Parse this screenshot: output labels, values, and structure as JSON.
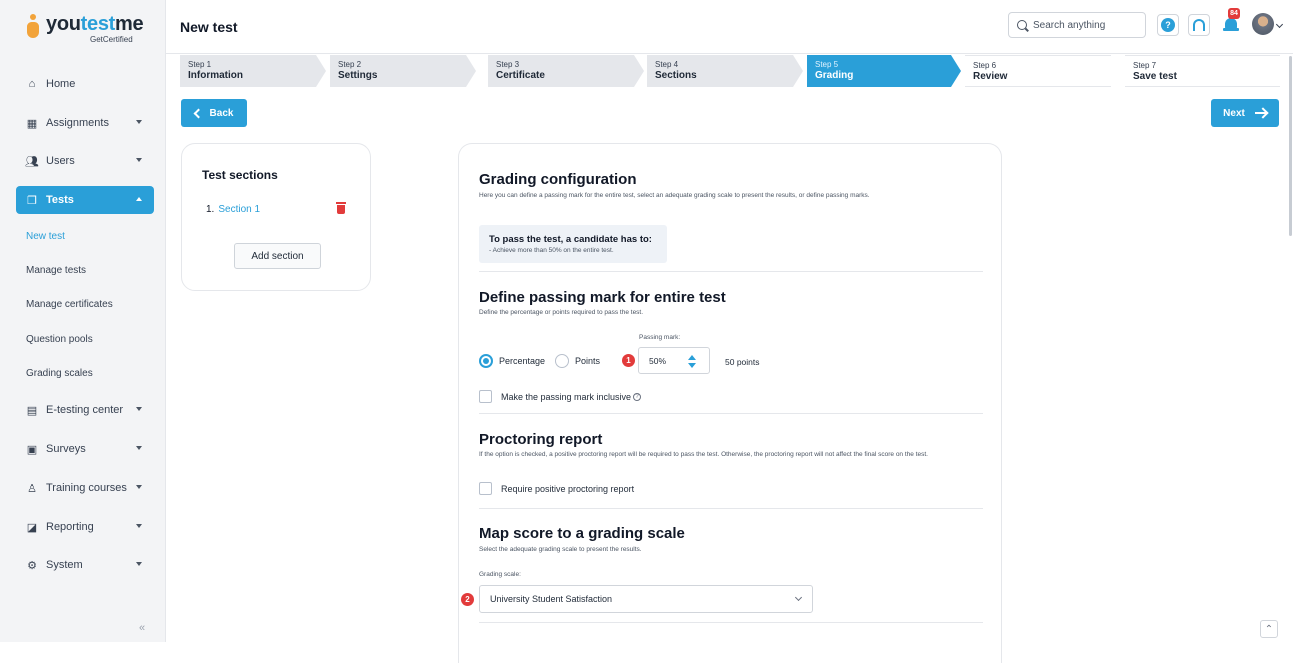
{
  "app": {
    "logo_prefix": "you",
    "logo_highlight": "test",
    "logo_suffix": "me",
    "logo_sub": "GetCertified"
  },
  "sidebar": {
    "items": [
      {
        "label": "Home",
        "icon": "home-icon"
      },
      {
        "label": "Assignments",
        "icon": "assignments-icon"
      },
      {
        "label": "Users",
        "icon": "users-icon"
      },
      {
        "label": "Tests",
        "icon": "tests-icon"
      },
      {
        "label": "E-testing center",
        "icon": "e-testing-icon"
      },
      {
        "label": "Surveys",
        "icon": "surveys-icon"
      },
      {
        "label": "Training courses",
        "icon": "trophy-icon"
      },
      {
        "label": "Reporting",
        "icon": "reporting-icon"
      },
      {
        "label": "System",
        "icon": "gear-icon"
      }
    ],
    "sub_items": [
      "New test",
      "Manage tests",
      "Manage certificates",
      "Question pools",
      "Grading scales"
    ],
    "collapse_label": "«"
  },
  "header": {
    "title": "New test",
    "search_placeholder": "Search anything",
    "notifications_count": "84",
    "help_label": "?"
  },
  "steps": [
    {
      "num": "Step 1",
      "label": "Information"
    },
    {
      "num": "Step 2",
      "label": "Settings"
    },
    {
      "num": "Step 3",
      "label": "Certificate"
    },
    {
      "num": "Step 4",
      "label": "Sections"
    },
    {
      "num": "Step 5",
      "label": "Grading"
    },
    {
      "num": "Step 6",
      "label": "Review"
    },
    {
      "num": "Step 7",
      "label": "Save test"
    }
  ],
  "nav_buttons": {
    "back": "Back",
    "next": "Next"
  },
  "sections_panel": {
    "title": "Test sections",
    "item_number": "1.",
    "item_label": "Section 1",
    "add_label": "Add section"
  },
  "grading": {
    "title": "Grading configuration",
    "description": "Here you can define a passing mark for the entire test, select an adequate grading scale to present the results, or define passing marks.",
    "info_title": "To pass the test, a candidate has to:",
    "info_text": "- Achieve more than 50% on the entire test."
  },
  "passing": {
    "title": "Define passing mark for entire test",
    "description": "Define the percentage or points required to pass the test.",
    "option_percentage": "Percentage",
    "option_points": "Points",
    "selected": "Percentage",
    "field_label": "Passing mark:",
    "value": "50%",
    "points_text": "50 points",
    "inclusive_label": "Make the passing mark inclusive",
    "inclusive_checked": false,
    "marker": "1"
  },
  "proctoring": {
    "title": "Proctoring report",
    "description": "If the option is checked, a positive proctoring report will be required to pass the test. Otherwise, the proctoring report will not affect the final score on the test.",
    "checkbox_label": "Require positive proctoring report",
    "checked": false
  },
  "grading_scale": {
    "title": "Map score to a grading scale",
    "description": "Select the adequate grading scale to present the results.",
    "field_label": "Grading scale:",
    "selected": "University Student Satisfaction",
    "marker": "2"
  },
  "colors": {
    "accent": "#2a9fd8",
    "marker_red": "#e23b3b"
  }
}
